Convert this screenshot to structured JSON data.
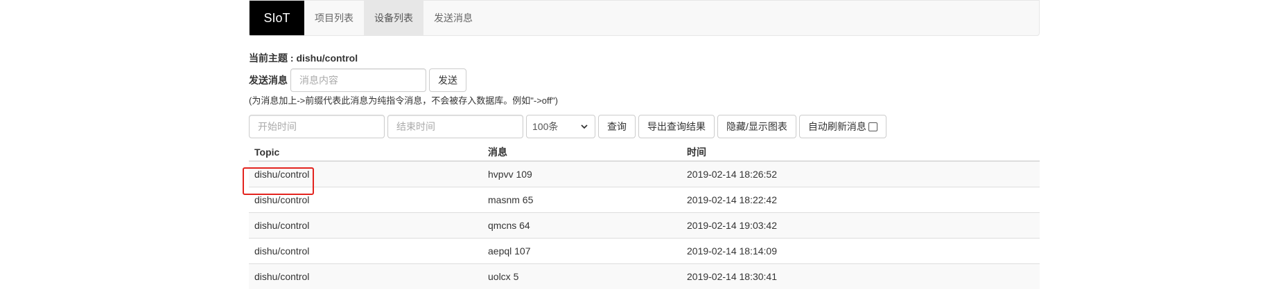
{
  "navbar": {
    "brand": "SIoT",
    "items": [
      {
        "label": "项目列表",
        "active": false
      },
      {
        "label": "设备列表",
        "active": true
      },
      {
        "label": "发送消息",
        "active": false
      }
    ]
  },
  "topic": {
    "label": "当前主题 : dishu/control"
  },
  "send": {
    "label": "发送消息",
    "placeholder": "消息内容",
    "button": "发送",
    "hint": "(为消息加上->前缀代表此消息为纯指令消息，不会被存入数据库。例如\"->off\")"
  },
  "query": {
    "start_placeholder": "开始时间",
    "end_placeholder": "结束时间",
    "limit_selected": "100条",
    "query_button": "查询",
    "export_button": "导出查询结果",
    "toggle_chart_button": "隐藏/显示图表",
    "auto_refresh_label": "自动刷新消息"
  },
  "table": {
    "headers": [
      "Topic",
      "消息",
      "时间"
    ],
    "rows": [
      {
        "topic": "dishu/control",
        "message": "hvpvv 109",
        "time": "2019-02-14 18:26:52"
      },
      {
        "topic": "dishu/control",
        "message": "masnm 65",
        "time": "2019-02-14 18:22:42"
      },
      {
        "topic": "dishu/control",
        "message": "qmcns 64",
        "time": "2019-02-14 19:03:42"
      },
      {
        "topic": "dishu/control",
        "message": "aepql 107",
        "time": "2019-02-14 18:14:09"
      },
      {
        "topic": "dishu/control",
        "message": "uolcx 5",
        "time": "2019-02-14 18:30:41"
      }
    ]
  },
  "colors": {
    "brand_bg": "#000000",
    "highlight": "#e3231e"
  }
}
